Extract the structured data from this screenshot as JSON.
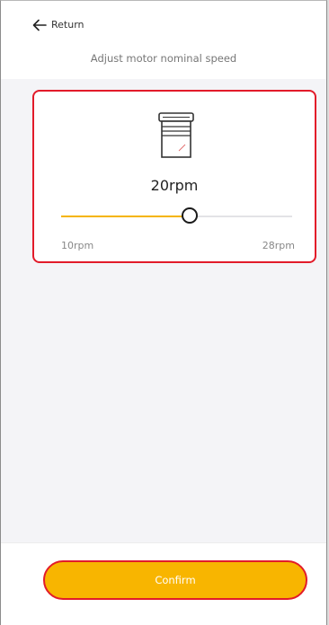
{
  "header": {
    "back_label": "Return",
    "subtitle": "Adjust motor nominal speed"
  },
  "speed_card": {
    "device_icon": "roller-blind-icon",
    "current_value": "20rpm",
    "slider": {
      "min": 10,
      "max": 28,
      "value": 20,
      "min_label": "10rpm",
      "max_label": "28rpm"
    }
  },
  "footer": {
    "confirm_label": "Confirm"
  },
  "colors": {
    "accent": "#f8b500",
    "highlight_border": "#e21b2a",
    "track": "#e3e3e6",
    "background": "#f4f4f7"
  }
}
